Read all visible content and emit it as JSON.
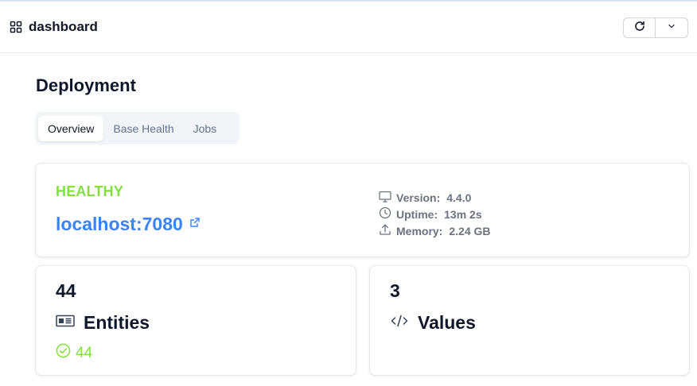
{
  "header": {
    "title": "dashboard",
    "icons": {
      "app": "grid-icon",
      "refresh": "refresh-icon",
      "more": "chevron-down-icon"
    }
  },
  "page": {
    "title": "Deployment"
  },
  "tabs": [
    {
      "label": "Overview",
      "active": true
    },
    {
      "label": "Base Health",
      "active": false
    },
    {
      "label": "Jobs",
      "active": false
    }
  ],
  "status": {
    "label": "HEALTHY",
    "host": "localhost:7080",
    "color": "#84e03f",
    "link_color": "#3b82f6",
    "details": [
      {
        "icon": "monitor-icon",
        "key": "Version:",
        "value": "4.4.0"
      },
      {
        "icon": "clock-icon",
        "key": "Uptime:",
        "value": "13m 2s"
      },
      {
        "icon": "upload-icon",
        "key": "Memory:",
        "value": "2.24 GB"
      }
    ]
  },
  "stats": [
    {
      "count": "44",
      "title": "Entities",
      "icon": "id-card-icon",
      "ok": "44"
    },
    {
      "count": "3",
      "title": "Values",
      "icon": "code-icon"
    }
  ]
}
